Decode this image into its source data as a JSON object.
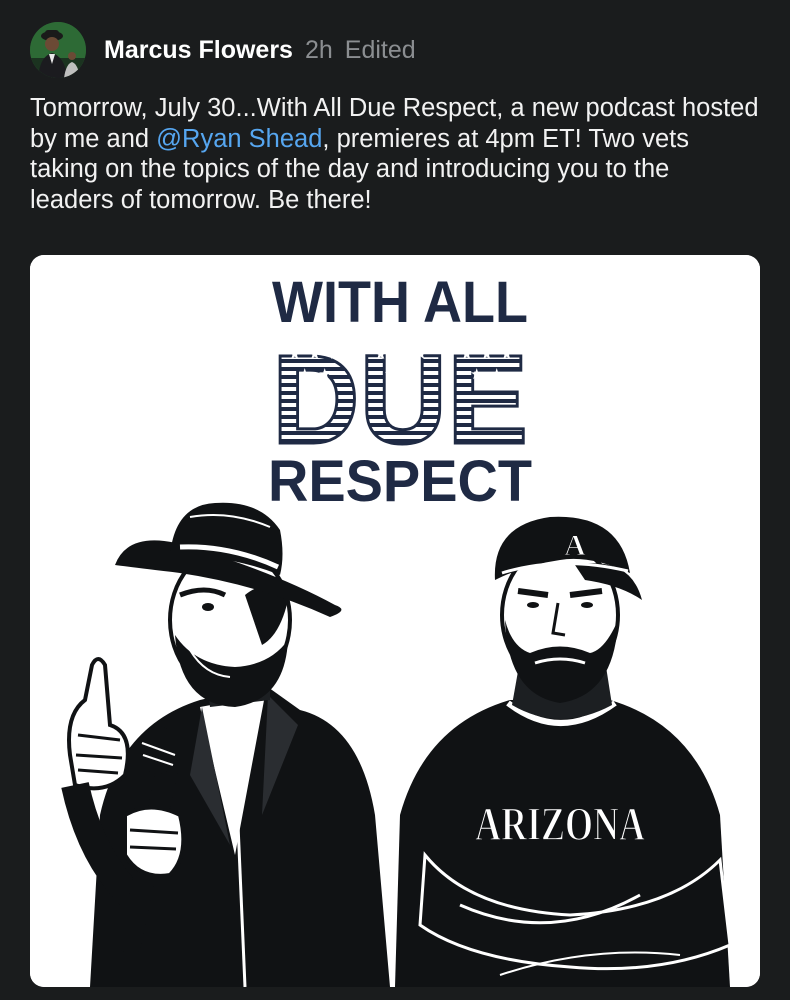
{
  "post": {
    "author": "Marcus Flowers",
    "time": "2h",
    "edited_label": "Edited",
    "text_before": "Tomorrow, July 30...With All Due Respect, a new podcast hosted by me and ",
    "mention": "@Ryan Shead",
    "text_after": ", premieres at 4pm ET! Two vets taking on the topics of the day and introducing you to the leaders of tomorrow. Be there!"
  },
  "image": {
    "title_line1": "WITH ALL",
    "title_line2": "DUE",
    "title_line3": "RESPECT",
    "cap_logo": "A",
    "sweatshirt_text": "ARIZONA",
    "colors": {
      "navy": "#1f2a44",
      "ink": "#101214",
      "paper": "#ffffff"
    }
  },
  "colors": {
    "background": "#1a1c1d",
    "mention": "#56a6f0",
    "meta": "#8b8e91"
  }
}
